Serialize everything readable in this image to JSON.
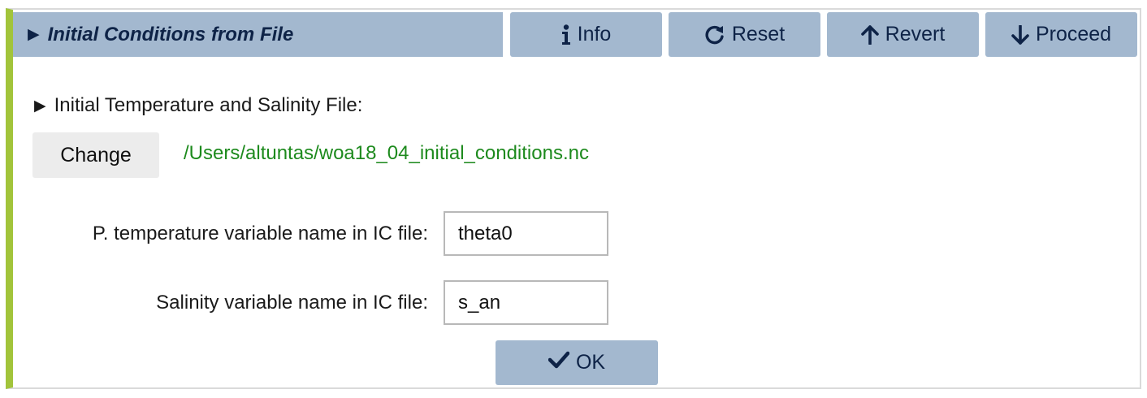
{
  "header": {
    "title": "Initial Conditions from File",
    "buttons": {
      "info": "Info",
      "reset": "Reset",
      "revert": "Revert",
      "proceed": "Proceed"
    }
  },
  "file_section": {
    "title": "Initial Temperature and Salinity File:",
    "change_label": "Change",
    "path": "/Users/altuntas/woa18_04_initial_conditions.nc"
  },
  "fields": {
    "temperature": {
      "label": "P. temperature variable name in IC file:",
      "value": "theta0"
    },
    "salinity": {
      "label": "Salinity variable name in IC file:",
      "value": "s_an"
    }
  },
  "ok_label": "OK",
  "colors": {
    "accent_bar": "#a2c43b",
    "button_bg": "#a3b8cf",
    "button_text": "#0e2347",
    "path_text": "#1d8a1d"
  }
}
